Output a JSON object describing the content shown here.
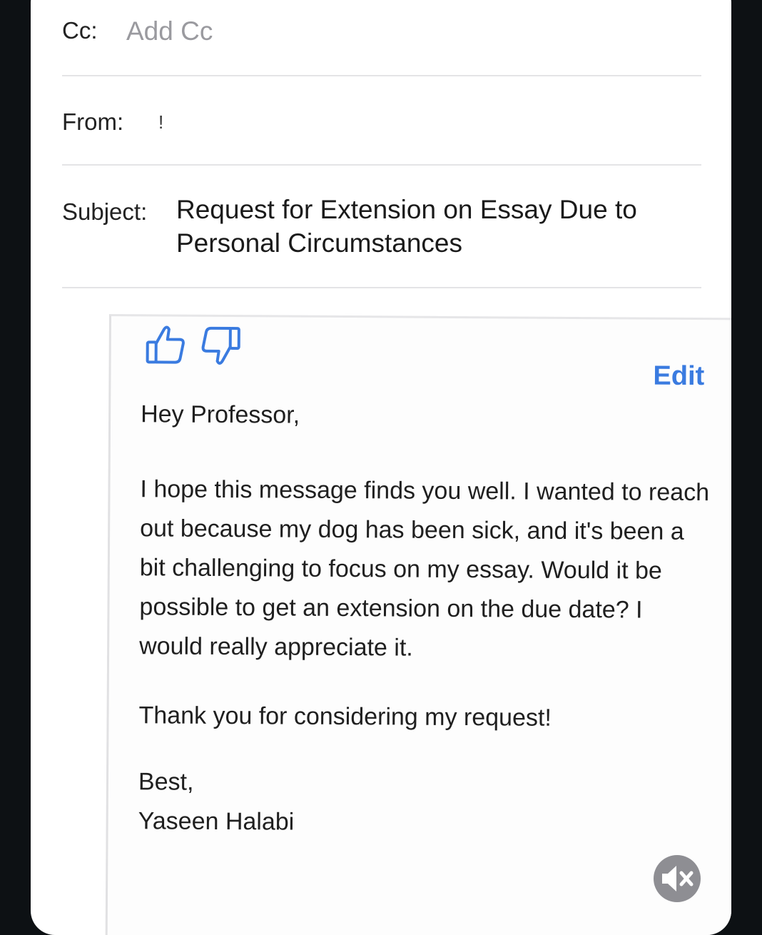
{
  "header": {
    "cc_label": "Cc:",
    "cc_placeholder": "Add Cc",
    "from_label": "From:",
    "from_value": "!",
    "subject_label": "Subject:",
    "subject_value": "Request for Extension on Essay Due to Personal Circumstances"
  },
  "suggestion": {
    "edit_label": "Edit",
    "thumbs_up_icon": "thumbs-up-icon",
    "thumbs_down_icon": "thumbs-down-icon",
    "accent_color": "#3a7be0",
    "greeting": "Hey Professor,",
    "paragraph1": "I hope this message finds you well. I wanted to reach out because my dog has been sick, and it's been a bit challenging to focus on my essay. Would it be possible to get an extension on the due date? I would really appreciate it.",
    "paragraph2": "Thank you for considering my request!",
    "signoff": "Best,",
    "signature": "Yaseen Halabi"
  },
  "overlay": {
    "mute_icon": "speaker-muted-icon"
  }
}
